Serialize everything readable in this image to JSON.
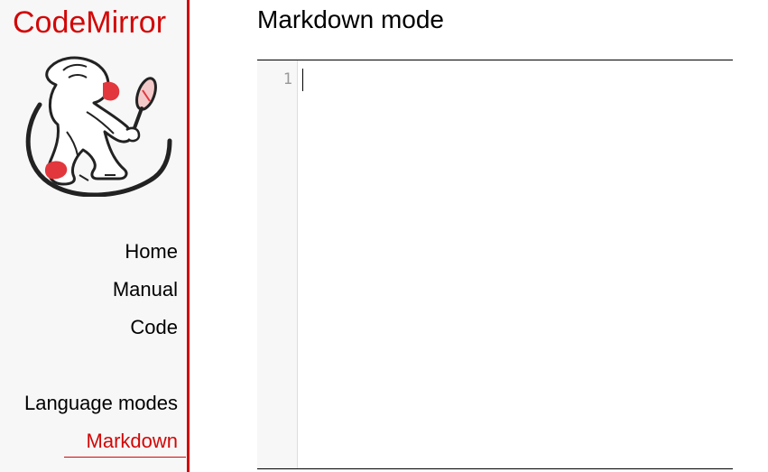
{
  "sidebar": {
    "brand": "CodeMirror",
    "nav": {
      "home": "Home",
      "manual": "Manual",
      "code": "Code",
      "language_modes": "Language modes",
      "markdown": "Markdown"
    }
  },
  "main": {
    "title": "Markdown mode",
    "editor": {
      "line_numbers": [
        "1"
      ],
      "content": ""
    }
  },
  "colors": {
    "accent": "#d30707",
    "sidebar_bg": "#f7f7f7",
    "gutter_bg": "#f7f7f7",
    "line_number": "#999999"
  }
}
